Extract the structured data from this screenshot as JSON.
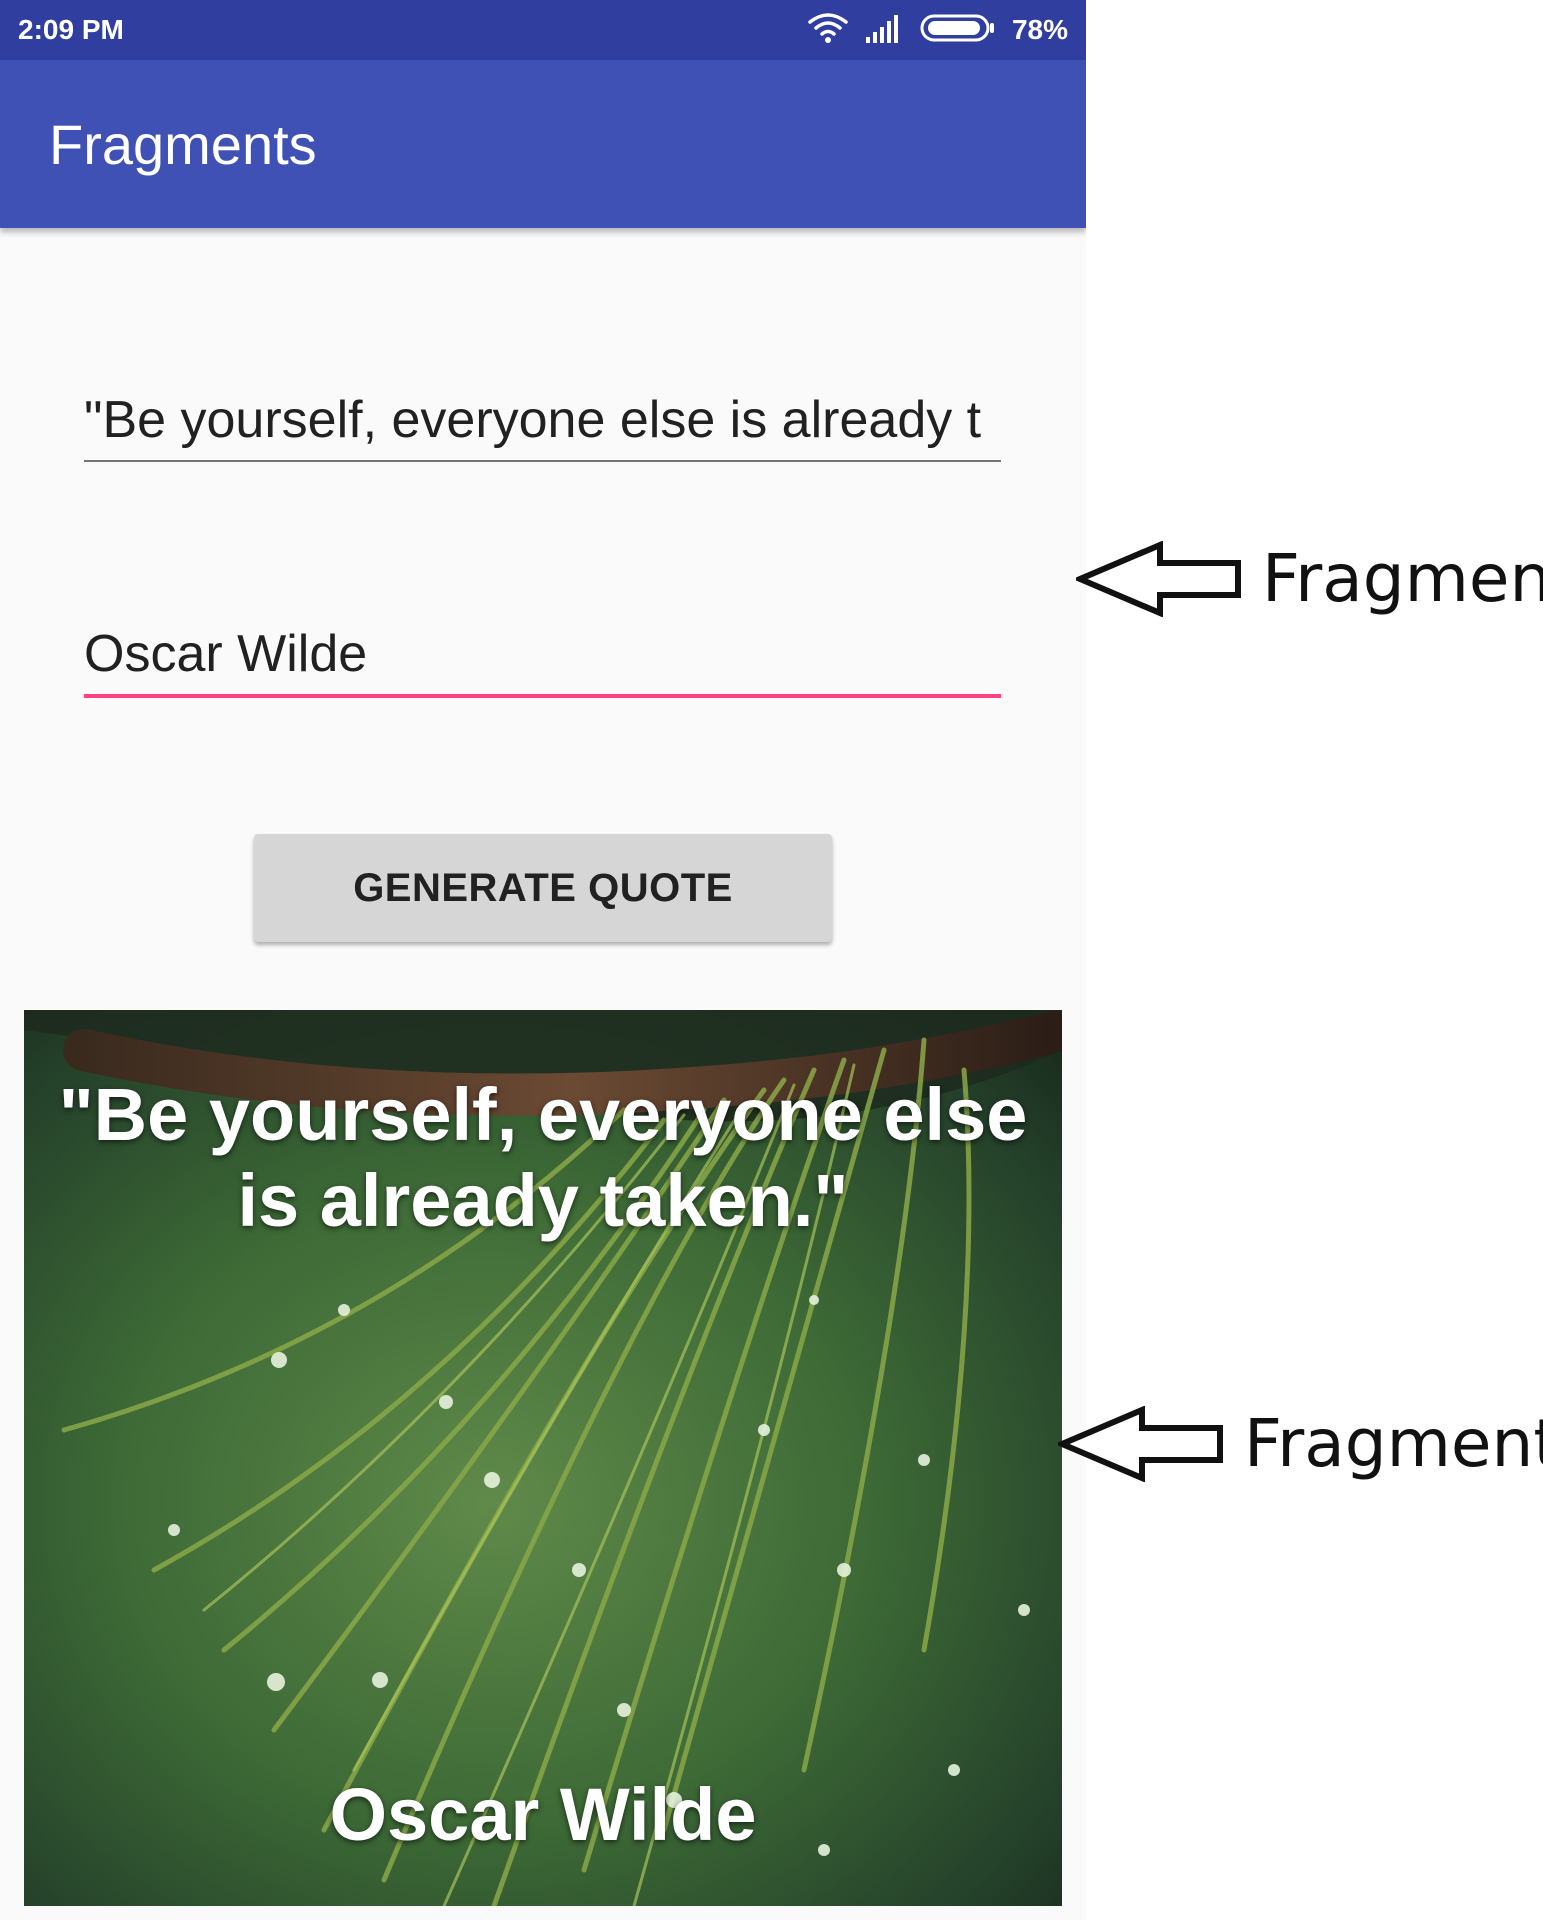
{
  "status_bar": {
    "time": "2:09 PM",
    "battery_percent": "78%",
    "icons": [
      "wifi-icon",
      "signal-icon",
      "battery-icon"
    ]
  },
  "app_bar": {
    "title": "Fragments"
  },
  "form": {
    "quote_value": "\"Be yourself, everyone else is already t",
    "author_value": "Oscar Wilde",
    "generate_label": "GENERATE QUOTE"
  },
  "quote_card": {
    "quote": "\"Be yourself, everyone else is already taken.\"",
    "author": "Oscar Wilde"
  },
  "annotations": {
    "top_label": "Fragment",
    "bottom_label": "Fragment"
  },
  "colors": {
    "status_bar": "#303f9f",
    "app_bar": "#3f51b5",
    "accent": "#ff4081",
    "button": "#d6d6d6"
  }
}
